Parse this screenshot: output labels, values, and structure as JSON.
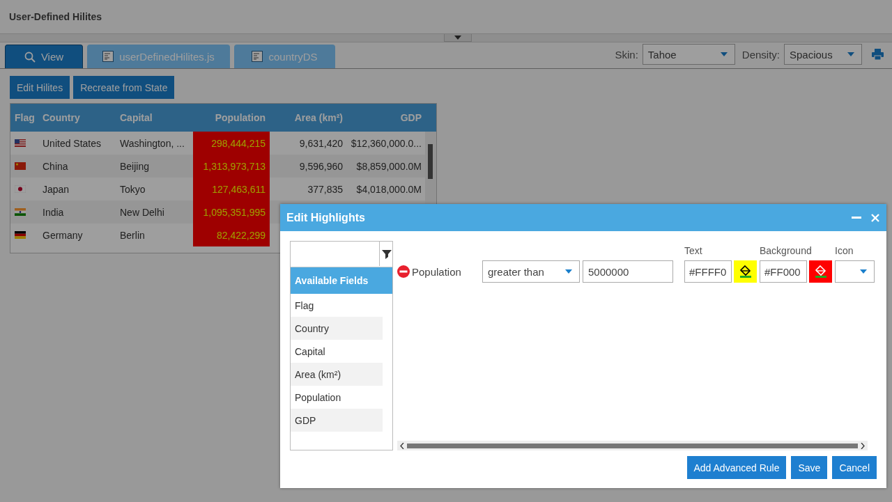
{
  "page_title": "User-Defined Hilites",
  "tabs": [
    {
      "label": "View",
      "kind": "search",
      "selected": true
    },
    {
      "label": "userDefinedHilites.js",
      "kind": "file",
      "selected": false
    },
    {
      "label": "countryDS",
      "kind": "file",
      "selected": false
    }
  ],
  "skin": {
    "label": "Skin:",
    "value": "Tahoe"
  },
  "density": {
    "label": "Density:",
    "value": "Spacious"
  },
  "toolbar_buttons": [
    "Edit Hilites",
    "Recreate from State"
  ],
  "grid": {
    "columns": [
      {
        "label": "Flag",
        "highlighted": false
      },
      {
        "label": "Country",
        "highlighted": false
      },
      {
        "label": "Capital",
        "highlighted": false
      },
      {
        "label": "Population",
        "highlighted": true
      },
      {
        "label": "Area (km²)",
        "highlighted": false
      },
      {
        "label": "GDP",
        "highlighted": false
      }
    ],
    "rows": [
      {
        "kind": "us",
        "cells": [
          "",
          "United States",
          "Washington, ...",
          "298,444,215",
          "9,631,420",
          "$12,360,000.0..."
        ]
      },
      {
        "kind": "cn",
        "cells": [
          "",
          "China",
          "Beijing",
          "1,313,973,713",
          "9,596,960",
          "$8,859,000.0M"
        ]
      },
      {
        "kind": "jp",
        "cells": [
          "",
          "Japan",
          "Tokyo",
          "127,463,611",
          "377,835",
          "$4,018,000.0M"
        ]
      },
      {
        "kind": "in",
        "cells": [
          "",
          "India",
          "New Delhi",
          "1,095,351,995",
          "",
          ""
        ]
      },
      {
        "kind": "de",
        "cells": [
          "",
          "Germany",
          "Berlin",
          "82,422,299",
          "",
          ""
        ]
      }
    ]
  },
  "dialog": {
    "title": "Edit Highlights",
    "fields_header": "Available Fields",
    "fields": [
      "Flag",
      "Country",
      "Capital",
      "Area (km²)",
      "Population",
      "GDP"
    ],
    "rule": {
      "field": "Population",
      "operator": "greater than",
      "value": "5000000",
      "text_label": "Text",
      "text_value": "#FFFF0",
      "text_swatch": {
        "color": "#ffff00"
      },
      "background_label": "Background",
      "background_value": "#FF000",
      "background_swatch": {
        "color": "#ff0000"
      },
      "icon_label": "Icon"
    },
    "buttons": [
      "Add Advanced Rule",
      "Save",
      "Cancel"
    ]
  }
}
